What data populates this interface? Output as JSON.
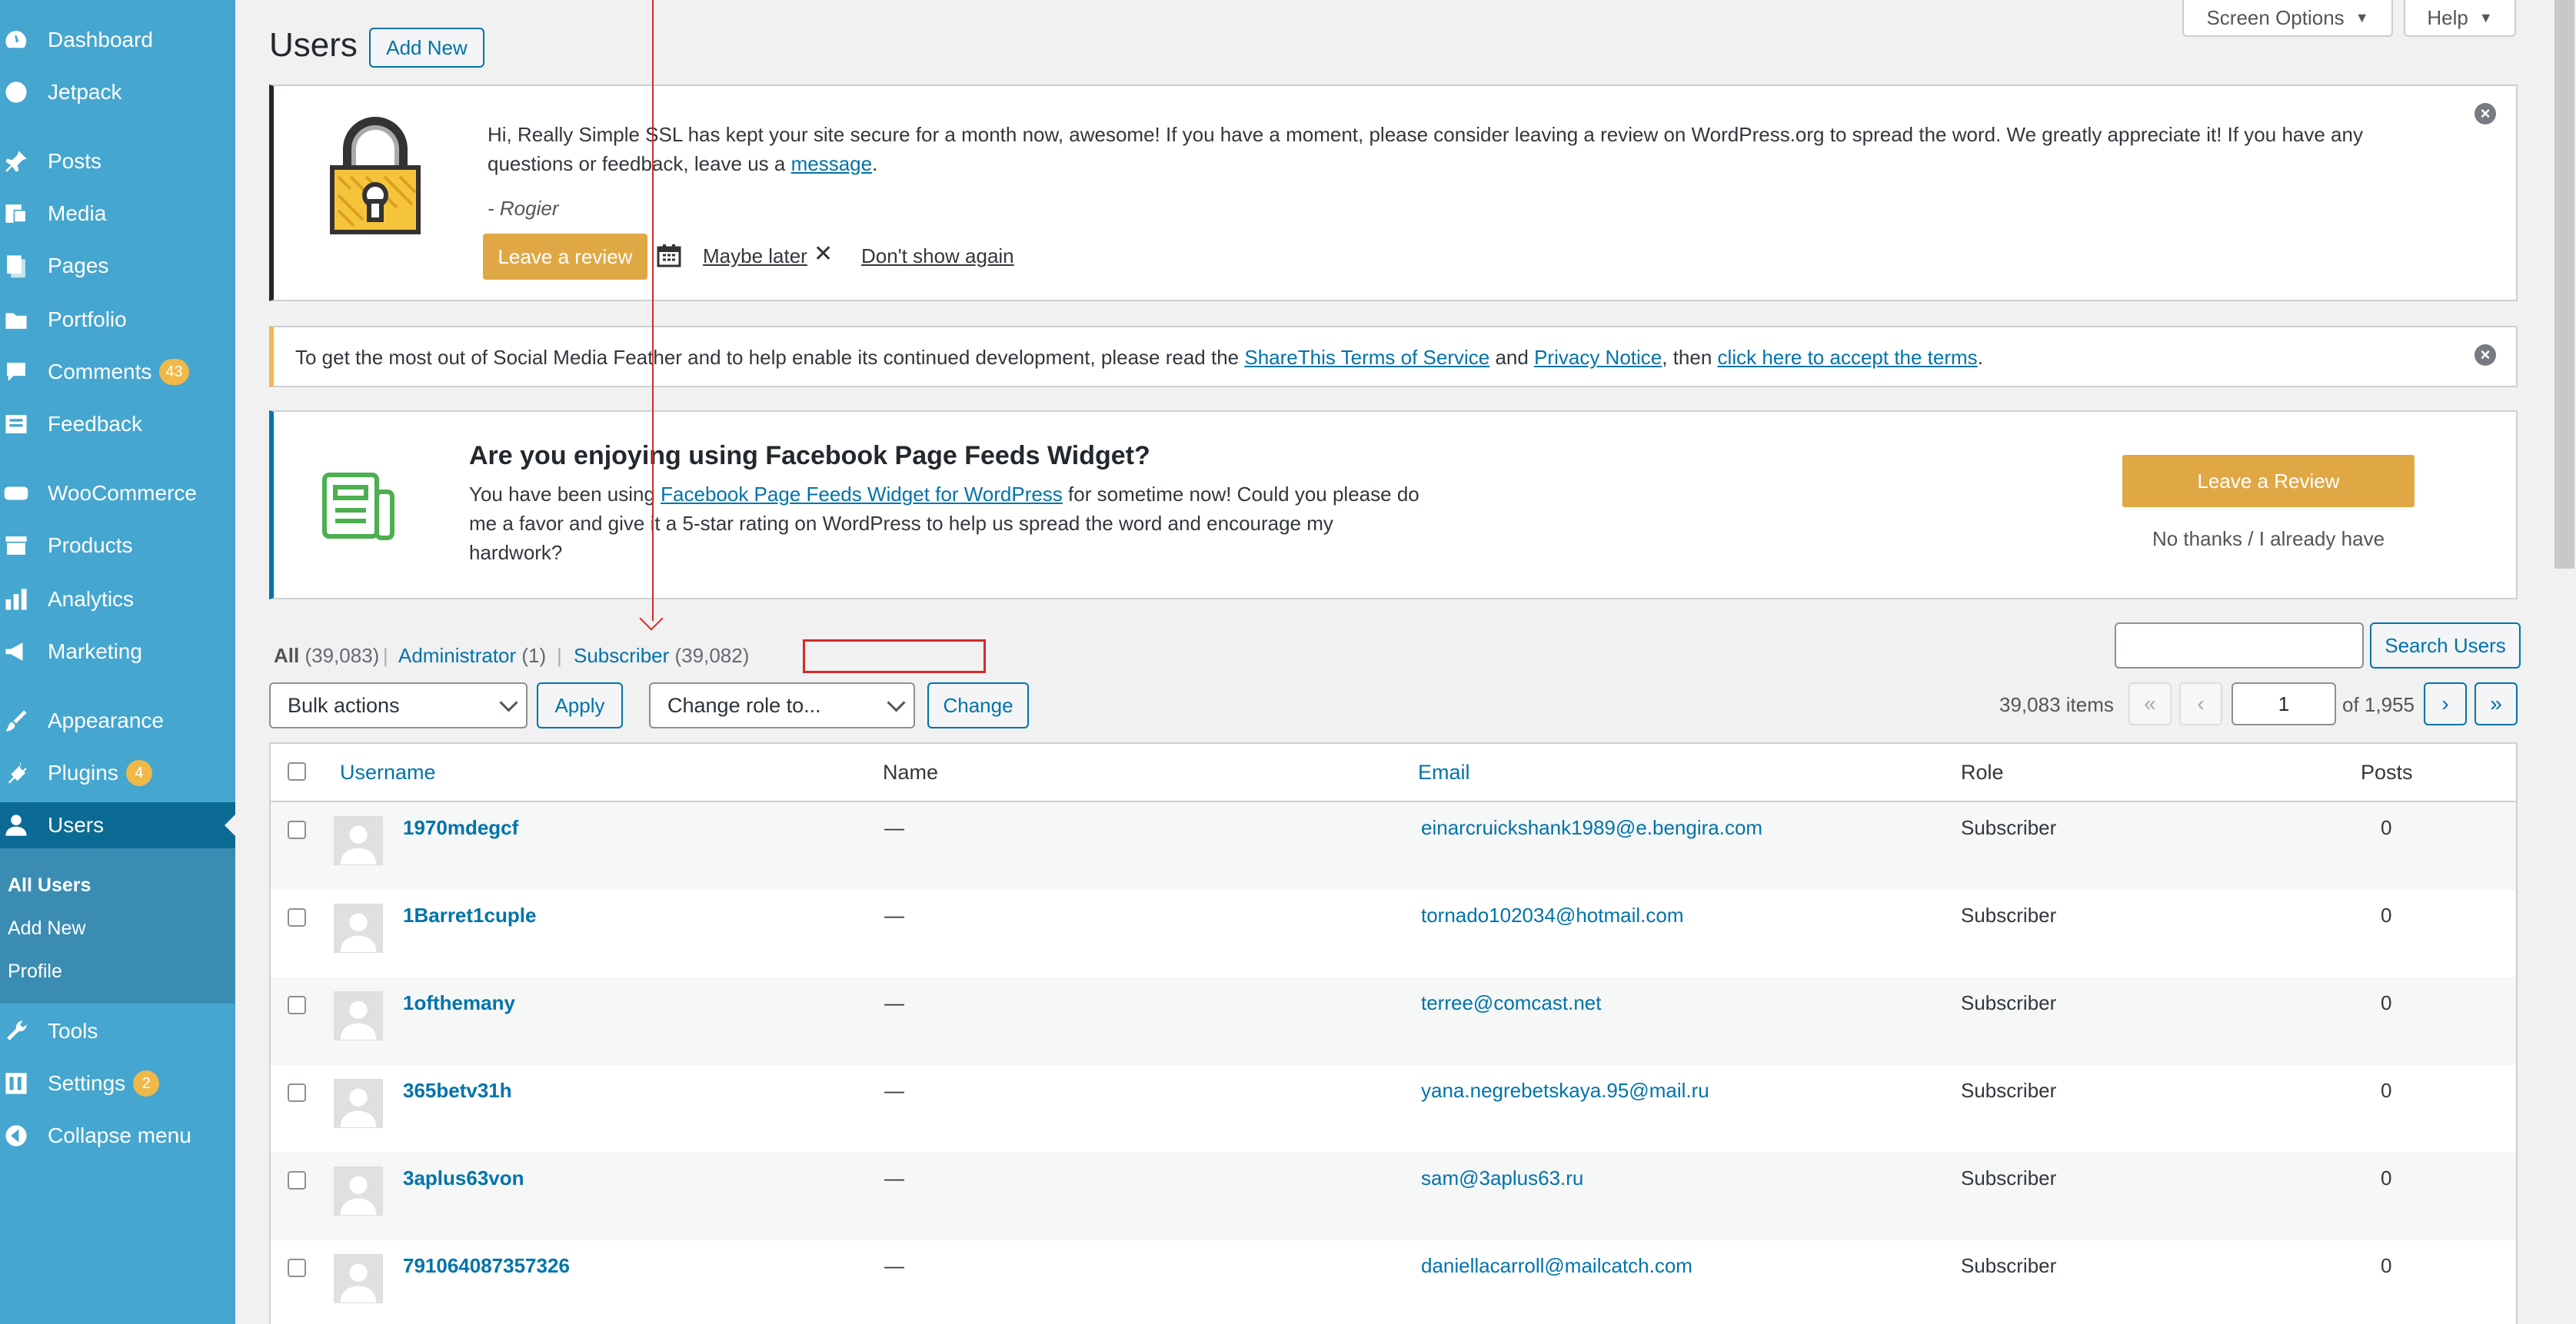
{
  "sidebar": {
    "items": [
      {
        "id": "dashboard",
        "label": "Dashboard",
        "icon": "dashboard-icon"
      },
      {
        "id": "jetpack",
        "label": "Jetpack",
        "icon": "jetpack-icon"
      },
      {
        "id": "posts",
        "label": "Posts",
        "icon": "pin-icon"
      },
      {
        "id": "media",
        "label": "Media",
        "icon": "media-icon"
      },
      {
        "id": "pages",
        "label": "Pages",
        "icon": "pages-icon"
      },
      {
        "id": "portfolio",
        "label": "Portfolio",
        "icon": "folder-icon"
      },
      {
        "id": "comments",
        "label": "Comments",
        "icon": "comment-icon",
        "badge": "43"
      },
      {
        "id": "feedback",
        "label": "Feedback",
        "icon": "feedback-icon"
      },
      {
        "id": "woocommerce",
        "label": "WooCommerce",
        "icon": "woo-icon"
      },
      {
        "id": "products",
        "label": "Products",
        "icon": "archive-icon"
      },
      {
        "id": "analytics",
        "label": "Analytics",
        "icon": "bar-chart-icon"
      },
      {
        "id": "marketing",
        "label": "Marketing",
        "icon": "megaphone-icon"
      },
      {
        "id": "appearance",
        "label": "Appearance",
        "icon": "paintbrush-icon"
      },
      {
        "id": "plugins",
        "label": "Plugins",
        "icon": "plug-icon",
        "badge": "4"
      },
      {
        "id": "users",
        "label": "Users",
        "icon": "user-icon"
      },
      {
        "id": "tools",
        "label": "Tools",
        "icon": "wrench-icon"
      },
      {
        "id": "settings",
        "label": "Settings",
        "icon": "settings-icon",
        "badge": "2"
      },
      {
        "id": "collapse",
        "label": "Collapse menu",
        "icon": "collapse-icon"
      }
    ],
    "submenu": [
      "All Users",
      "Add New",
      "Profile"
    ]
  },
  "header": {
    "screen_options": "Screen Options",
    "help": "Help",
    "title": "Users",
    "add_new": "Add New"
  },
  "notice_ssl": {
    "text": "Hi, Really Simple SSL has kept your site secure for a month now, awesome! If you have a moment, please consider leaving a review on WordPress.org to spread the word. We greatly appreciate it! If you have any questions or feedback, leave us a",
    "link": "message",
    "period": ".",
    "signature": "- Rogier",
    "leave_review": "Leave a review",
    "maybe_later": "Maybe later",
    "dont_show": "Don't show again"
  },
  "notice_share": {
    "text1": "To get the most out of Social Media Feather and to help enable its continued development, please read the",
    "link1": "ShareThis Terms of Service",
    "and": "and",
    "link2": "Privacy Notice",
    "then": ", then",
    "link3": "click here to accept the terms",
    "period": "."
  },
  "notice_fb": {
    "title": "Are you enjoying using Facebook Page Feeds Widget?",
    "line1_pre": "You have been using",
    "link": "Facebook Page Feeds Widget for WordPress",
    "line1_post": "for sometime now! Could you please do",
    "line2": "me a favor and give it a 5-star rating on WordPress to help us spread the word and encourage my",
    "line3": "hardwork?",
    "leave_review": "Leave a Review",
    "no_thanks": "No thanks / I already have"
  },
  "filters": {
    "all": "All",
    "all_count": "(39,083)",
    "admin": "Administrator",
    "admin_count": "(1)",
    "subscriber": "Subscriber",
    "subscriber_count": "(39,082)",
    "sep": "|"
  },
  "search": {
    "value": "",
    "button": "Search Users"
  },
  "bulk": {
    "selected": "Bulk actions",
    "apply": "Apply",
    "role": "Change role to...",
    "change": "Change"
  },
  "pagination": {
    "items": "39,083 items",
    "first": "«",
    "prev": "‹",
    "current": "1",
    "of": "of 1,955",
    "next": "›",
    "last": "»"
  },
  "table": {
    "columns": {
      "username": "Username",
      "name": "Name",
      "email": "Email",
      "role": "Role",
      "posts": "Posts"
    },
    "rows": [
      {
        "username": "1970mdegcf",
        "name": "—",
        "email": "einarcruickshank1989@e.bengira.com",
        "role": "Subscriber",
        "posts": "0"
      },
      {
        "username": "1Barret1cuple",
        "name": "—",
        "email": "tornado102034@hotmail.com",
        "role": "Subscriber",
        "posts": "0"
      },
      {
        "username": "1ofthemany",
        "name": "—",
        "email": "terree@comcast.net",
        "role": "Subscriber",
        "posts": "0"
      },
      {
        "username": "365betv31h",
        "name": "—",
        "email": "yana.negrebetskaya.95@mail.ru",
        "role": "Subscriber",
        "posts": "0"
      },
      {
        "username": "3aplus63von",
        "name": "—",
        "email": "sam@3aplus63.ru",
        "role": "Subscriber",
        "posts": "0"
      },
      {
        "username": "791064087357326",
        "name": "—",
        "email": "daniellacarroll@mailcatch.com",
        "role": "Subscriber",
        "posts": "0"
      }
    ]
  },
  "colors": {
    "sidebar": "#45a6cf",
    "accent": "#0073aa",
    "review": "#e0a845",
    "highlight": "#d42a2a"
  }
}
